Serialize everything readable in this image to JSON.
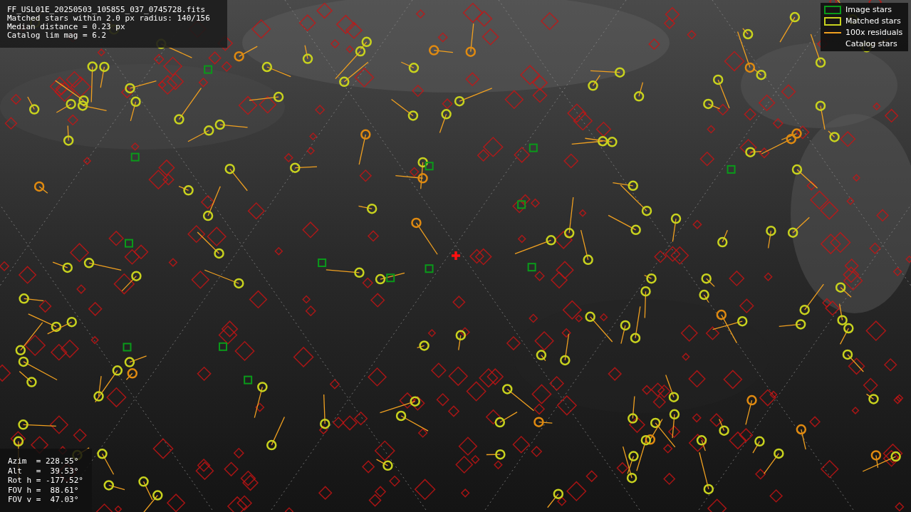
{
  "info_panel": {
    "lines": [
      "FF_USL01E_20250503_105855_037_0745728.fits",
      "Matched stars within 2.0 px radius: 140/156",
      "Median distance = 0.23 px",
      "Catalog lim mag = 6.2"
    ]
  },
  "legend": [
    {
      "label": "Image stars"
    },
    {
      "kind": "matched",
      "label": "Matched stars"
    },
    {
      "kind": "residual",
      "label": "100x residuals"
    },
    {
      "kind": "catalog",
      "label": "Catalog stars"
    }
  ],
  "pointing_panel": {
    "lines": [
      "Azim  = 228.55°",
      "Alt   =  39.53°",
      "Rot h = -177.52°",
      "FOV h =  88.61°",
      "FOV v =  47.03°"
    ]
  }
}
